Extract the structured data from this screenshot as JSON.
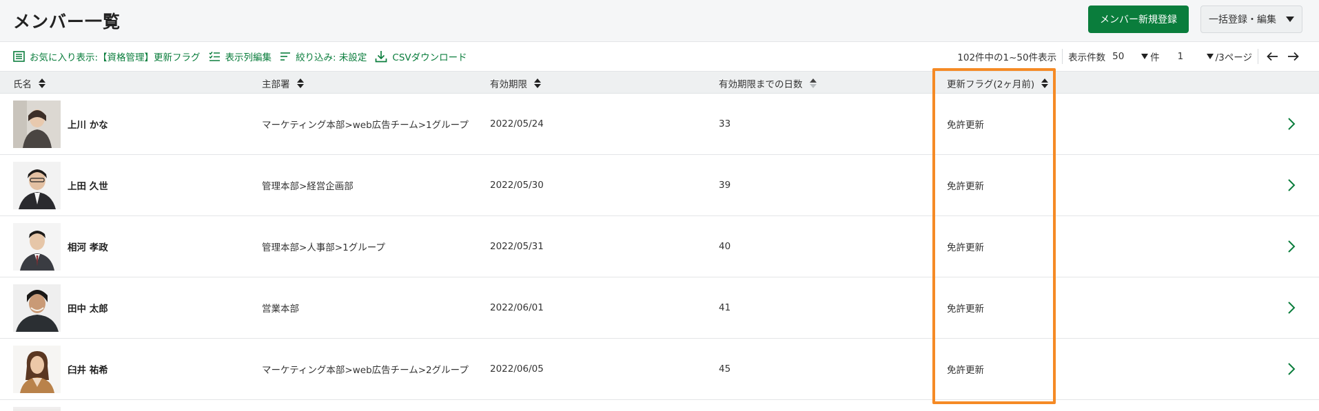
{
  "header": {
    "title": "メンバー一覧",
    "new_button": "メンバー新規登録",
    "bulk_button": "一括登録・編集"
  },
  "toolbar": {
    "favorite": "お気に入り表示:【資格管理】更新フラグ",
    "columns_edit": "表示列編集",
    "filter": "絞り込み: 未設定",
    "csv": "CSVダウンロード"
  },
  "pager": {
    "summary": "102件中の1~50件表示",
    "per_page_label": "表示件数",
    "per_page_value": "50",
    "per_page_unit": "件",
    "page_value": "1",
    "page_total": "/3ページ"
  },
  "table": {
    "columns": [
      "氏名",
      "主部署",
      "有効期限",
      "有効期限までの日数",
      "更新フラグ(2ヶ月前)"
    ],
    "rows": [
      {
        "name": "上川 かな",
        "dept": "マーケティング本部>web広告チーム>1グループ",
        "expiry": "2022/05/24",
        "days": "33",
        "flag": "免許更新"
      },
      {
        "name": "上田 久世",
        "dept": "管理本部>経営企画部",
        "expiry": "2022/05/30",
        "days": "39",
        "flag": "免許更新"
      },
      {
        "name": "相河 孝政",
        "dept": "管理本部>人事部>1グループ",
        "expiry": "2022/05/31",
        "days": "40",
        "flag": "免許更新"
      },
      {
        "name": "田中 太郎",
        "dept": "営業本部",
        "expiry": "2022/06/01",
        "days": "41",
        "flag": "免許更新"
      },
      {
        "name": "臼井 祐希",
        "dept": "マーケティング本部>web広告チーム>2グループ",
        "expiry": "2022/06/05",
        "days": "45",
        "flag": "免許更新"
      }
    ]
  },
  "colors": {
    "accent": "#0a7d3c",
    "highlight": "#f58a25"
  }
}
